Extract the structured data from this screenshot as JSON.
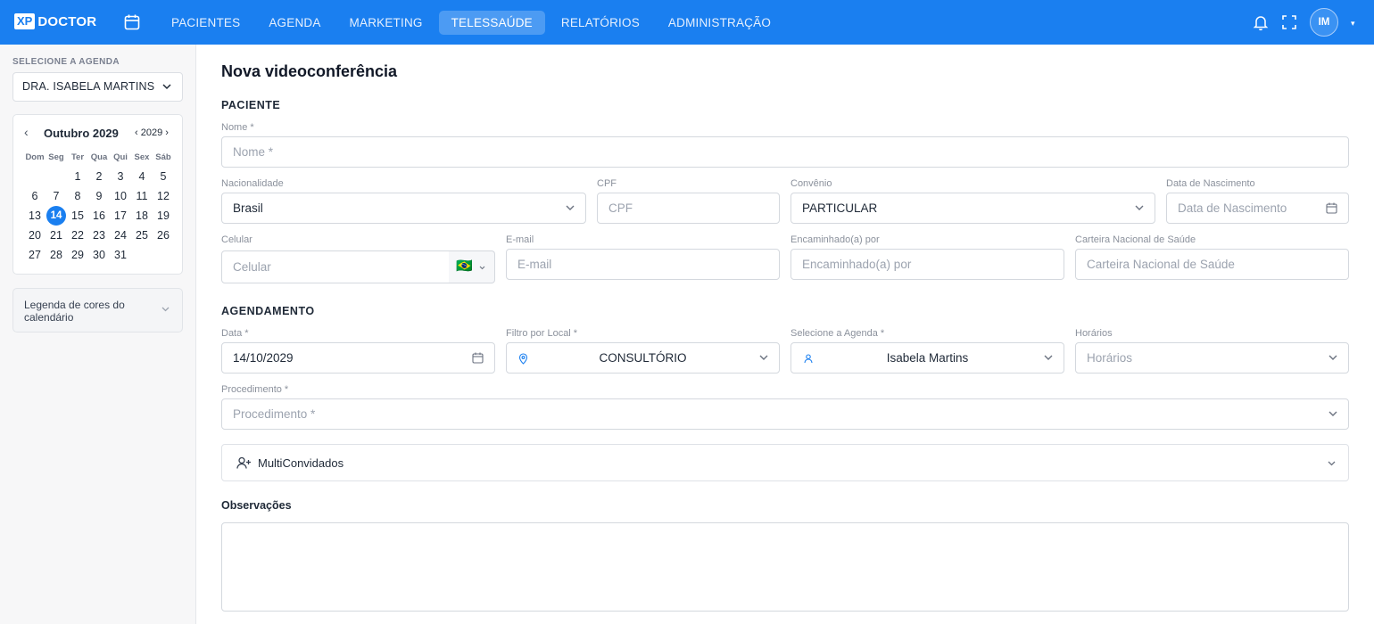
{
  "brand": {
    "xp": "XP",
    "name": "DOCTOR"
  },
  "nav": [
    {
      "label": "PACIENTES",
      "active": false
    },
    {
      "label": "AGENDA",
      "active": false
    },
    {
      "label": "MARKETING",
      "active": false
    },
    {
      "label": "TELESSAÚDE",
      "active": true
    },
    {
      "label": "RELATÓRIOS",
      "active": false
    },
    {
      "label": "ADMINISTRAÇÃO",
      "active": false
    }
  ],
  "user": {
    "initials": "IM"
  },
  "icons": {
    "calendar": "calendar-icon",
    "bell": "bell-icon",
    "fullscreen": "fullscreen-icon"
  },
  "sidebar": {
    "label": "SELECIONE A AGENDA",
    "agenda_value": "DRA. ISABELA MARTINS",
    "calendar": {
      "prev": "‹",
      "month": "Outubro 2029",
      "year": "‹ 2029 ›",
      "weekdays": [
        "Dom",
        "Seg",
        "Ter",
        "Qua",
        "Qui",
        "Sex",
        "Sáb"
      ],
      "weeks": [
        [
          "",
          "",
          "1",
          "2",
          "3",
          "4",
          "5"
        ],
        [
          "6",
          "7",
          "8",
          "9",
          "10",
          "11",
          "12"
        ],
        [
          "13",
          "14",
          "15",
          "16",
          "17",
          "18",
          "19"
        ],
        [
          "20",
          "21",
          "22",
          "23",
          "24",
          "25",
          "26"
        ],
        [
          "27",
          "28",
          "29",
          "30",
          "31",
          "",
          ""
        ]
      ],
      "today": "14"
    },
    "legend": "Legenda de cores do calendário"
  },
  "form": {
    "title": "Nova videoconferência",
    "paciente_section": "PACIENTE",
    "nome": {
      "label": "Nome *",
      "placeholder": "Nome *"
    },
    "nacionalidade": {
      "label": "Nacionalidade",
      "value": "Brasil"
    },
    "cpf": {
      "label": "CPF",
      "placeholder": "CPF"
    },
    "convenio": {
      "label": "Convênio",
      "value": "PARTICULAR"
    },
    "nascimento": {
      "label": "Data de Nascimento",
      "placeholder": "Data de Nascimento"
    },
    "celular": {
      "label": "Celular",
      "placeholder": "Celular",
      "flag": "🇧🇷"
    },
    "email": {
      "label": "E-mail",
      "placeholder": "E-mail"
    },
    "encaminhado": {
      "label": "Encaminhado(a) por",
      "placeholder": "Encaminhado(a) por"
    },
    "cns": {
      "label": "Carteira Nacional de Saúde",
      "placeholder": "Carteira Nacional de Saúde"
    },
    "agendamento_section": "AGENDAMENTO",
    "data": {
      "label": "Data *",
      "value": "14/10/2029"
    },
    "local": {
      "label": "Filtro por Local *",
      "value": "CONSULTÓRIO"
    },
    "agenda": {
      "label": "Selecione a Agenda *",
      "value": "Isabela Martins"
    },
    "horarios": {
      "label": "Horários",
      "placeholder": "Horários"
    },
    "procedimento": {
      "label": "Procedimento *",
      "placeholder": "Procedimento *"
    },
    "multi": "MultiConvidados",
    "observacoes": "Observações"
  },
  "colors": {
    "primary": "#1a7ff0"
  }
}
